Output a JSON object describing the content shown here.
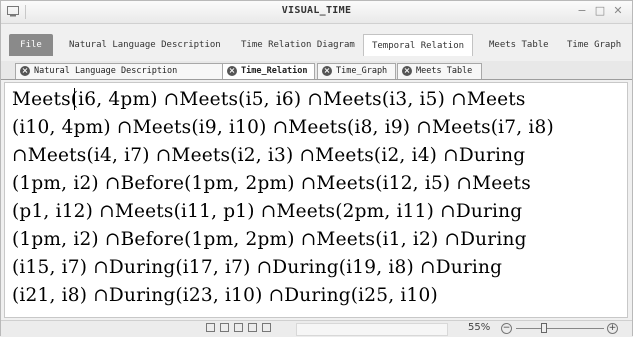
{
  "window": {
    "title": "VISUAL_TIME",
    "controls": {
      "minimize": "−",
      "maximize": "□",
      "close": "✕"
    }
  },
  "menu_tabs": [
    {
      "label": "File"
    },
    {
      "label": "Natural Language Description"
    },
    {
      "label": "Time Relation Diagram"
    },
    {
      "label": "Temporal Relation"
    },
    {
      "label": "Meets Table"
    },
    {
      "label": "Time Graph"
    }
  ],
  "doc_tabs": [
    {
      "label": "Natural Language Description"
    },
    {
      "label": "Time_Relation"
    },
    {
      "label": "Time_Graph"
    },
    {
      "label": "Meets Table"
    }
  ],
  "content": {
    "lines": [
      "Meets(i6, 4pm) ∩Meets(i5, i6) ∩Meets(i3, i5) ∩Meets",
      "(i10, 4pm) ∩Meets(i9, i10) ∩Meets(i8, i9) ∩Meets(i7, i8)",
      "∩Meets(i4, i7) ∩Meets(i2, i3) ∩Meets(i2, i4) ∩During",
      "(1pm, i2) ∩Before(1pm, 2pm) ∩Meets(i12, i5) ∩Meets",
      "(p1, i12) ∩Meets(i11, p1) ∩Meets(2pm, i11) ∩During",
      "(1pm, i2) ∩Before(1pm, 2pm) ∩Meets(i1, i2) ∩During",
      "(i15, i7) ∩During(i17, i7) ∩During(i19, i8) ∩During",
      "(i21, i8) ∩During(i23, i10) ∩During(i25, i10)"
    ]
  },
  "status": {
    "zoom": "55%",
    "zoom_out": "−",
    "zoom_in": "+"
  }
}
